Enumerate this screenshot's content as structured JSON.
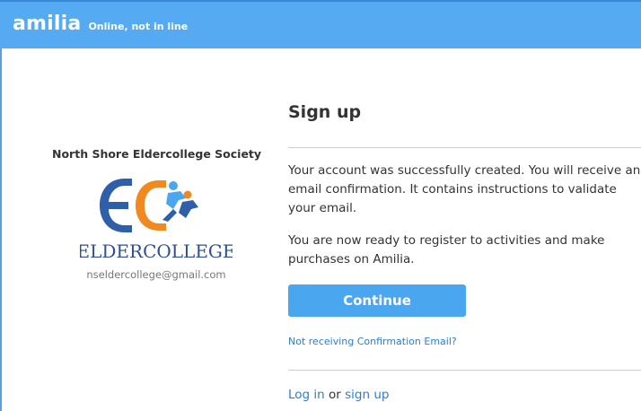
{
  "header": {
    "brand": "amilia",
    "tagline": "Online, not in line"
  },
  "organization": {
    "name": "North Shore Eldercollege Society",
    "logo_text": "ELDERCOLLEGE",
    "email": "nseldercollege@gmail.com"
  },
  "signup": {
    "title": "Sign up",
    "message_1": "Your account was successfully created. You will receive an email confirmation. It contains instructions to validate your email.",
    "message_2": "You are now ready to register to activities and make purchases on Amilia.",
    "continue_label": "Continue",
    "no_email_link": "Not receiving Confirmation Email?",
    "login_link": "Log in",
    "or_text": "or",
    "signup_link": "sign up"
  },
  "colors": {
    "header_bg": "#55aaf2",
    "button_bg": "#4aa6ee",
    "link": "#2a7fd4",
    "logo_blue": "#2e5fa8",
    "logo_orange": "#f08a1e"
  }
}
